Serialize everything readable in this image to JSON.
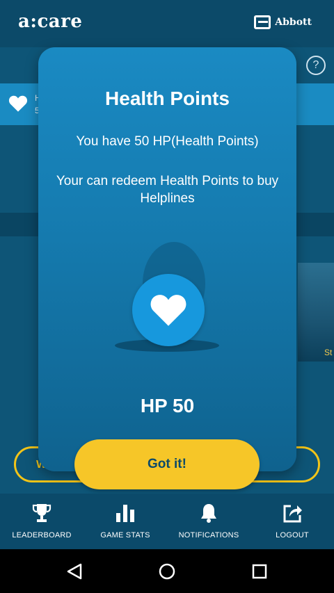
{
  "header": {
    "app_name": "a:care",
    "partner_name": "Abbott"
  },
  "background": {
    "hp_label": "H",
    "hp_value": "5",
    "help_icon": "?",
    "image_caption": "St",
    "pill_text": "W"
  },
  "modal": {
    "title": "Health Points",
    "message": "You have 50 HP(Health Points)",
    "hint": "Your can redeem Health Points to buy Helplines",
    "hp_total": "HP 50",
    "confirm_label": "Got it!"
  },
  "bottom_nav": {
    "items": [
      {
        "label": "LEADERBOARD",
        "icon": "trophy-icon"
      },
      {
        "label": "GAME STATS",
        "icon": "bar-chart-icon"
      },
      {
        "label": "NOTIFICATIONS",
        "icon": "bell-icon"
      },
      {
        "label": "LOGOUT",
        "icon": "share-exit-icon"
      }
    ]
  },
  "system_nav": {
    "back": "back-triangle-icon",
    "home": "home-circle-icon",
    "recents": "recents-square-icon"
  },
  "colors": {
    "header_bg": "#0c4a69",
    "modal_top": "#1a8ac3",
    "modal_bottom": "#0f628e",
    "accent_yellow": "#f6c628",
    "heart_circle": "#1798dd"
  }
}
